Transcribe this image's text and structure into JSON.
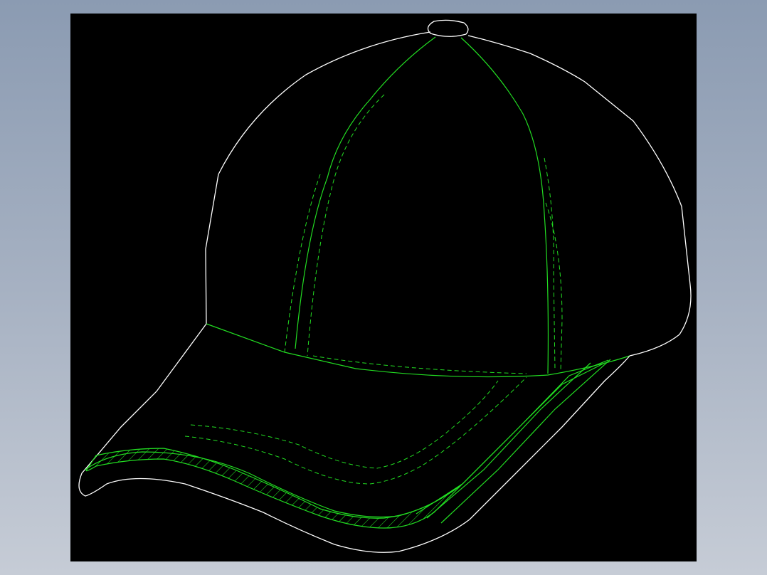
{
  "viewport": {
    "background_colors": [
      "#8b9bb2",
      "#c6ccd6"
    ],
    "canvas_color": "#000000"
  },
  "drawing": {
    "subject": "cap-icon",
    "outline_color": "#ffffff",
    "seam_color": "#22dd22",
    "stitch_color": "#22dd22",
    "hatch_color": "#22dd22",
    "parts": [
      "crown-outline",
      "top-button",
      "panel-seams",
      "stitching",
      "visor-outline",
      "visor-hatch-band"
    ]
  }
}
